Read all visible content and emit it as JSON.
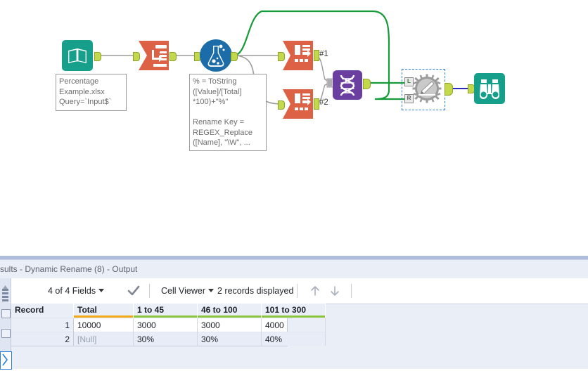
{
  "canvas": {
    "tools": [
      {
        "id": "input-data",
        "name": "Input Data",
        "icon": "book-icon",
        "color": "#16a08c"
      },
      {
        "id": "select",
        "name": "Select",
        "icon": "select-icon",
        "color": "#dd6145"
      },
      {
        "id": "formula",
        "name": "Formula",
        "icon": "flask-icon",
        "color": "#1b6ca8"
      },
      {
        "id": "transpose-1",
        "name": "Transpose",
        "icon": "transpose-icon",
        "color": "#dd6145"
      },
      {
        "id": "transpose-2",
        "name": "Transpose",
        "icon": "transpose-icon",
        "color": "#dd6145"
      },
      {
        "id": "union",
        "name": "Union",
        "icon": "dna-helix-icon",
        "color": "#6b3fa0"
      },
      {
        "id": "dynamic-rename",
        "name": "Dynamic Rename",
        "icon": "gear-pencil-icon",
        "color": "#9c9c9c"
      },
      {
        "id": "browse",
        "name": "Browse",
        "icon": "binoculars-icon",
        "color": "#16a08c"
      }
    ],
    "annotations": {
      "input": "Percentage\nExample.xlsx\nQuery=`Input$`",
      "formula": "% = ToString\n([Value]/[Total]\n*100)+\"%\"\n\nRename Key =\nREGEX_Replace\n([Name], \"\\W\", ..."
    },
    "connection_labels": {
      "first": "#1",
      "second": "#2"
    },
    "io_badges": {
      "left": "L",
      "right": "R"
    },
    "selected_tool": "dynamic-rename",
    "colors": {
      "highlight_wire": "#159b37",
      "normal_wire": "#9a9a9a",
      "browse_wire": "#2b2bbf",
      "selection": "#2a7fd4",
      "plug": "#c3d84b"
    }
  },
  "results": {
    "title": "sults - Dynamic Rename (8) - Output",
    "toolbar": {
      "fields_label": "4 of 4 Fields",
      "viewer_label": "Cell Viewer",
      "records_label": "2 records displayed",
      "check_icon": "check-icon",
      "up_icon": "arrow-up-icon",
      "down_icon": "arrow-down-icon"
    },
    "table": {
      "columns": [
        {
          "label": "Record",
          "bar": "none"
        },
        {
          "label": "Total",
          "bar": "#f0a818"
        },
        {
          "label": "1 to 45",
          "bar": "#8dc63f"
        },
        {
          "label": "46 to 100",
          "bar": "#8dc63f"
        },
        {
          "label": "101 to 300",
          "bar": "#8dc63f"
        }
      ],
      "rows": [
        {
          "record": "1",
          "cells": [
            "10000",
            "3000",
            "3000",
            "4000"
          ],
          "null_index": -1
        },
        {
          "record": "2",
          "cells": [
            "[Null]",
            "30%",
            "30%",
            "40%"
          ],
          "null_index": 0
        }
      ]
    }
  }
}
